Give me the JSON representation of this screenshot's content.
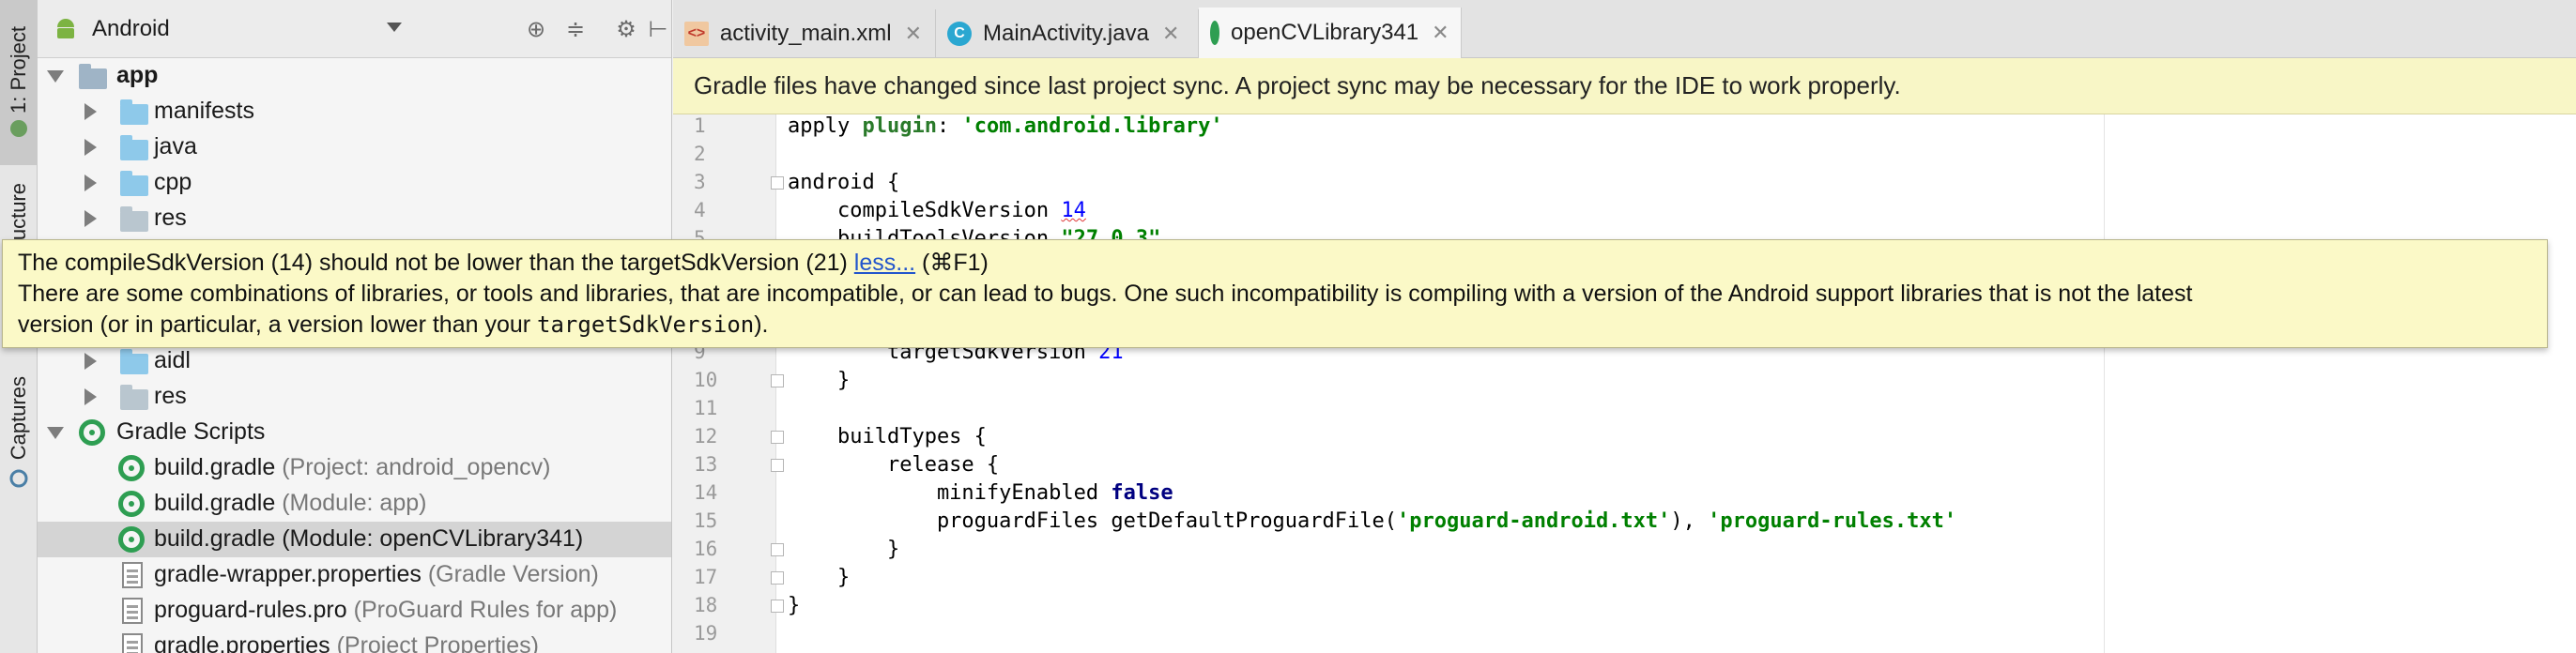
{
  "toolstrip": {
    "project_tab": "1: Project",
    "structure_tab": "ucture",
    "captures_tab": "Captures"
  },
  "project_panel": {
    "view_mode": "Android",
    "tree": [
      {
        "label": "app",
        "bold": true
      },
      {
        "label": "manifests"
      },
      {
        "label": "java"
      },
      {
        "label": "cpp"
      },
      {
        "label": "res"
      },
      {
        "label": "aidl"
      },
      {
        "label": "res"
      },
      {
        "label": "Gradle Scripts"
      },
      {
        "label": "build.gradle",
        "hint": "(Project: android_opencv)"
      },
      {
        "label": "build.gradle",
        "hint": "(Module: app)"
      },
      {
        "label": "build.gradle",
        "hint": "(Module: openCVLibrary341)",
        "selected": true
      },
      {
        "label": "gradle-wrapper.properties",
        "hint": "(Gradle Version)"
      },
      {
        "label": "proguard-rules.pro",
        "hint": "(ProGuard Rules for app)"
      },
      {
        "label": "gradle.properties",
        "hint": "(Project Properties)"
      }
    ]
  },
  "tabs": [
    {
      "label": "activity_main.xml",
      "icon": "xml-file-icon"
    },
    {
      "label": "MainActivity.java",
      "icon": "java-class-icon"
    },
    {
      "label": "openCVLibrary341",
      "icon": "gradle-icon",
      "active": true
    }
  ],
  "notice": "Gradle files have changed since last project sync. A project sync may be necessary for the IDE to work properly.",
  "editor": {
    "line_numbers": [
      "1",
      "2",
      "3",
      "4",
      "5",
      "9",
      "10",
      "11",
      "12",
      "13",
      "14",
      "15",
      "16",
      "17",
      "18",
      "19"
    ],
    "lines": {
      "l1_a": "apply ",
      "l1_b": "plugin",
      "l1_c": ": ",
      "l1_d": "'com.android.library'",
      "l3": "android {",
      "l4_a": "    compileSdkVersion ",
      "l4_b": "14",
      "l5_a": "    buildToolsVersion ",
      "l5_b": "\"27.0.3\"",
      "l9_a": "        targetSdkVersion ",
      "l9_b": "21",
      "l10": "    }",
      "l12": "    buildTypes {",
      "l13": "        release {",
      "l14_a": "            minifyEnabled ",
      "l14_b": "false",
      "l15_a": "            proguardFiles getDefaultProguardFile(",
      "l15_b": "'proguard-android.txt'",
      "l15_c": "), ",
      "l15_d": "'proguard-rules.txt'",
      "l16": "        }",
      "l17": "    }",
      "l18": "}"
    }
  },
  "tooltip": {
    "line1": "The compileSdkVersion (14) should not be lower than the targetSdkVersion (21)",
    "less_link": "less...",
    "shortcut": "(⌘F1)",
    "line2": "There are some combinations of libraries, or tools and libraries, that are incompatible, or can lead to bugs. One such incompatibility is compiling with a version of the Android support libraries that is not the latest",
    "line3_a": "version (or in particular, a version lower than your ",
    "line3_code": "targetSdkVersion",
    "line3_b": ")."
  }
}
